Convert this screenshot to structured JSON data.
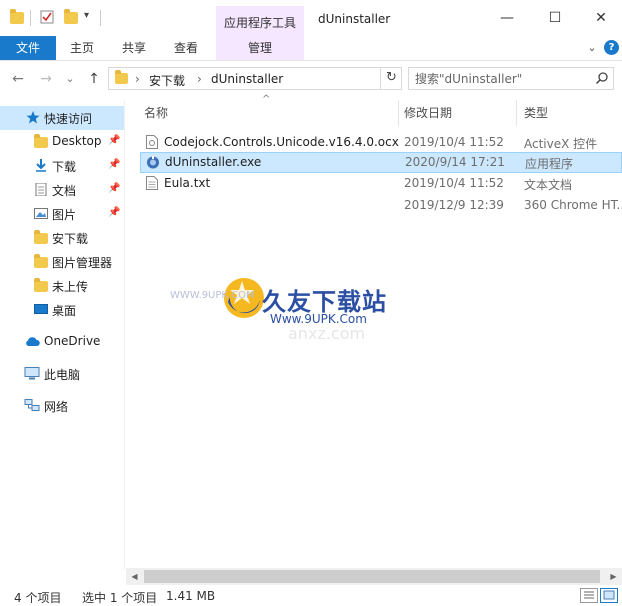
{
  "window": {
    "title": "dUninstaller",
    "context_group": "应用程序工具",
    "minimize": "—",
    "maximize": "☐",
    "close": "✕"
  },
  "ribbon": {
    "tabs": [
      "文件",
      "主页",
      "共享",
      "查看",
      "管理"
    ],
    "chevron": "⌄",
    "help": "?"
  },
  "address": {
    "back": "←",
    "forward": "→",
    "recent": "⌄",
    "up": "↑",
    "sep": "›",
    "crumbs": [
      "安下载",
      "dUninstaller"
    ],
    "dropdown": "⌄",
    "refresh": "↻"
  },
  "search": {
    "placeholder": "搜索\"dUninstaller\""
  },
  "nav": {
    "items": [
      {
        "label": "快速访问",
        "icon": "star-icon"
      },
      {
        "label": "Desktop",
        "icon": "folder-icon",
        "pinned": true
      },
      {
        "label": "下载",
        "icon": "download-icon",
        "pinned": true
      },
      {
        "label": "文档",
        "icon": "document-icon",
        "pinned": true
      },
      {
        "label": "图片",
        "icon": "picture-icon",
        "pinned": true
      },
      {
        "label": "安下载",
        "icon": "folder-icon"
      },
      {
        "label": "图片管理器",
        "icon": "folder-icon"
      },
      {
        "label": "未上传",
        "icon": "folder-icon"
      },
      {
        "label": "桌面",
        "icon": "desktop-icon"
      },
      {
        "label": "OneDrive",
        "icon": "cloud-icon"
      },
      {
        "label": "此电脑",
        "icon": "computer-icon"
      },
      {
        "label": "网络",
        "icon": "network-icon"
      }
    ],
    "pin": "📌"
  },
  "columns": {
    "name": "名称",
    "modified": "修改日期",
    "type": "类型",
    "sort_arrow": "^"
  },
  "files": [
    {
      "name": "Codejock.Controls.Unicode.v16.4.0.ocx",
      "modified": "2019/10/4 11:52",
      "type": "ActiveX 控件",
      "icon": "ocx-file-icon"
    },
    {
      "name": "dUninstaller.exe",
      "modified": "2020/9/14 17:21",
      "type": "应用程序",
      "icon": "exe-file-icon",
      "selected": true
    },
    {
      "name": "Eula.txt",
      "modified": "2019/10/4 11:52",
      "type": "文本文档",
      "icon": "text-file-icon"
    },
    {
      "name": "",
      "modified": "2019/12/9 12:39",
      "type": "360 Chrome HT...",
      "icon": "html-file-icon"
    }
  ],
  "watermark": {
    "brand": "久友下载站",
    "url": "Www.9UPK.Com",
    "url_small": "WWW.9UPK.COM",
    "faint": "anxz.com"
  },
  "scrollbar": {
    "left": "◀",
    "right": "▶"
  },
  "status": {
    "item_count": "4 个项目",
    "selection": "选中 1 个项目",
    "size": "1.41 MB"
  },
  "colors": {
    "accent": "#1979ca",
    "selection": "#cce8ff",
    "context_tab": "#f4e7ff",
    "watermark_blue": "#2b4fa3"
  }
}
